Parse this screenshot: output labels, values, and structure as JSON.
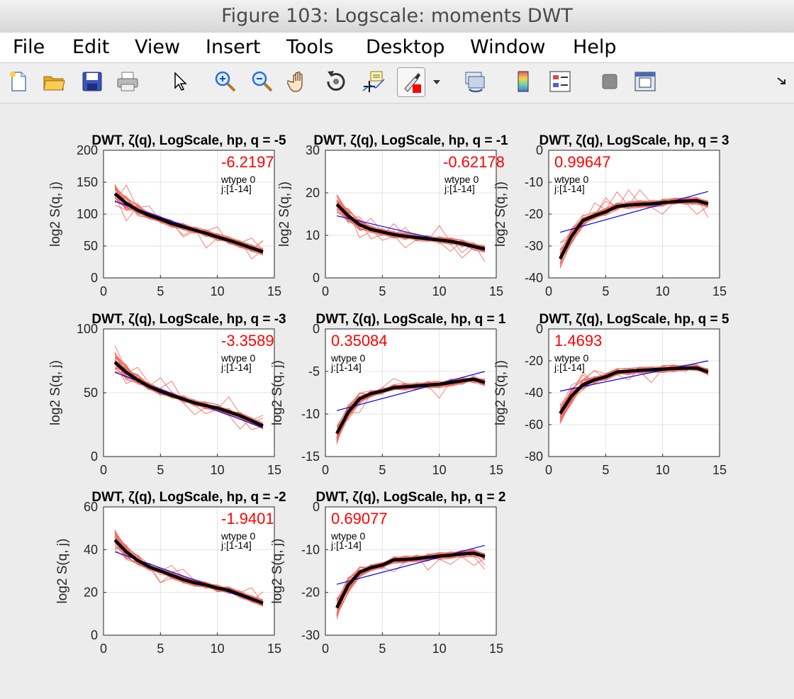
{
  "window": {
    "title": "Figure 103: Logscale: moments DWT"
  },
  "menu": [
    "File",
    "Edit",
    "View",
    "Insert",
    "Tools",
    "Desktop",
    "Window",
    "Help"
  ],
  "toolbar": {
    "buttons": [
      "new-figure-icon",
      "open-file-icon",
      "save-icon",
      "print-icon",
      "edit-plot-arrow-icon",
      "zoom-in-icon",
      "zoom-out-icon",
      "pan-hand-icon",
      "rotate-3d-icon",
      "data-cursor-icon",
      "brush-icon",
      "brush-dropdown-icon",
      "link-plot-icon",
      "insert-colorbar-icon",
      "insert-legend-icon",
      "hide-plot-tools-icon",
      "show-plot-tools-icon",
      "dock-arrow-icon"
    ]
  },
  "colors": {
    "red_lines": "#f06a60",
    "mean": "#000000",
    "fit": "#0000ff",
    "label_red": "#ff0000"
  },
  "chart_data": [
    {
      "type": "line",
      "title": "DWT, ζ(q), LogScale, hp, q = -5",
      "ylabel": "log2 S(q, j)",
      "xlim": [
        0,
        15
      ],
      "ylim": [
        0,
        200
      ],
      "xticks": [
        0,
        5,
        10,
        15
      ],
      "yticks": [
        0,
        50,
        100,
        150,
        200
      ],
      "grid": true,
      "annotation_value": "-6.2197",
      "annotation_text": [
        "wtype 0",
        "j:[1-14]"
      ],
      "mean": [
        132,
        117,
        106,
        98,
        92,
        85,
        80,
        75,
        70,
        64,
        59,
        53,
        47,
        41
      ],
      "fit": [
        {
          "x": 1,
          "y": 120
        },
        {
          "x": 14,
          "y": 39
        }
      ]
    },
    {
      "type": "line",
      "title": "DWT, ζ(q), LogScale, hp, q = -1",
      "ylabel": "log2 S(q, j)",
      "xlim": [
        0,
        15
      ],
      "ylim": [
        0,
        30
      ],
      "xticks": [
        0,
        5,
        10,
        15
      ],
      "yticks": [
        0,
        10,
        20,
        30
      ],
      "grid": true,
      "annotation_value": "-0.62178",
      "annotation_text": [
        "wtype 0",
        "j:[1-14]"
      ],
      "mean": [
        17.3,
        14.6,
        12.5,
        11.4,
        10.8,
        10.2,
        9.8,
        9.5,
        9.2,
        8.9,
        8.6,
        8.1,
        7.4,
        6.8
      ],
      "fit": [
        {
          "x": 1,
          "y": 14.6
        },
        {
          "x": 14,
          "y": 6.5
        }
      ]
    },
    {
      "type": "line",
      "title": "DWT, ζ(q), LogScale, hp, q = 3",
      "ylabel": "log2 S(q, j)",
      "xlim": [
        0,
        15
      ],
      "ylim": [
        -40,
        0
      ],
      "xticks": [
        0,
        5,
        10,
        15
      ],
      "yticks": [
        -40,
        -30,
        -20,
        -10,
        0
      ],
      "grid": true,
      "annotation_value": "0.99647",
      "annotation_text": [
        "wtype 0",
        "j:[1-14]"
      ],
      "mean": [
        -34,
        -27,
        -22,
        -20.5,
        -19.3,
        -17.6,
        -17.2,
        -16.9,
        -16.8,
        -16.4,
        -16.1,
        -15.9,
        -15.8,
        -16.8
      ],
      "fit": [
        {
          "x": 1,
          "y": -25.7
        },
        {
          "x": 14,
          "y": -12.9
        }
      ]
    },
    {
      "type": "line",
      "title": "DWT, ζ(q), LogScale, hp, q = -3",
      "ylabel": "log2 S(q, j)",
      "xlim": [
        0,
        15
      ],
      "ylim": [
        0,
        100
      ],
      "xticks": [
        0,
        5,
        10,
        15
      ],
      "yticks": [
        0,
        50,
        100
      ],
      "grid": true,
      "annotation_value": "-3.3589",
      "annotation_text": [
        "wtype 0",
        "j:[1-14]"
      ],
      "mean": [
        74,
        66,
        60,
        55,
        51,
        48,
        45,
        42,
        40,
        38,
        35,
        32,
        28,
        24
      ],
      "fit": [
        {
          "x": 1,
          "y": 66
        },
        {
          "x": 14,
          "y": 22.5
        }
      ]
    },
    {
      "type": "line",
      "title": "DWT, ζ(q), LogScale, hp, q = 1",
      "ylabel": "log2 S(q, j)",
      "xlim": [
        0,
        15
      ],
      "ylim": [
        -15,
        0
      ],
      "xticks": [
        0,
        5,
        10,
        15
      ],
      "yticks": [
        -15,
        -10,
        -5,
        0
      ],
      "grid": true,
      "annotation_value": "0.35084",
      "annotation_text": [
        "wtype 0",
        "j:[1-14]"
      ],
      "mean": [
        -12.3,
        -9.8,
        -8.2,
        -7.6,
        -7.3,
        -6.9,
        -6.8,
        -6.7,
        -6.6,
        -6.5,
        -6.3,
        -6.1,
        -5.9,
        -6.3
      ],
      "fit": [
        {
          "x": 1,
          "y": -9.6
        },
        {
          "x": 14,
          "y": -5.0
        }
      ]
    },
    {
      "type": "line",
      "title": "DWT, ζ(q), LogScale, hp, q = 5",
      "ylabel": "log2 S(q, j)",
      "xlim": [
        0,
        15
      ],
      "ylim": [
        -80,
        0
      ],
      "xticks": [
        0,
        5,
        10,
        15
      ],
      "yticks": [
        -80,
        -60,
        -40,
        -20,
        0
      ],
      "grid": true,
      "annotation_value": "1.4693",
      "annotation_text": [
        "wtype 0",
        "j:[1-14]"
      ],
      "mean": [
        -53,
        -42,
        -35,
        -32,
        -30,
        -27,
        -26.5,
        -26,
        -25.6,
        -25.2,
        -24.8,
        -24.6,
        -24.5,
        -27
      ],
      "fit": [
        {
          "x": 1,
          "y": -39
        },
        {
          "x": 14,
          "y": -20
        }
      ]
    },
    {
      "type": "line",
      "title": "DWT, ζ(q), LogScale, hp, q = -2",
      "ylabel": "log2 S(q, j)",
      "xlim": [
        0,
        15
      ],
      "ylim": [
        0,
        60
      ],
      "xticks": [
        0,
        5,
        10,
        15
      ],
      "yticks": [
        0,
        20,
        40,
        60
      ],
      "grid": true,
      "annotation_value": "-1.9401",
      "annotation_text": [
        "wtype 0",
        "j:[1-14]"
      ],
      "mean": [
        44.5,
        39,
        35,
        32,
        30,
        28,
        26,
        24.5,
        23.5,
        22,
        21,
        19,
        17,
        15
      ],
      "fit": [
        {
          "x": 1,
          "y": 39
        },
        {
          "x": 14,
          "y": 14.5
        }
      ]
    },
    {
      "type": "line",
      "title": "DWT, ζ(q), LogScale, hp, q = 2",
      "ylabel": "log2 S(q, j)",
      "xlim": [
        0,
        15
      ],
      "ylim": [
        -30,
        0
      ],
      "xticks": [
        0,
        5,
        10,
        15
      ],
      "yticks": [
        -30,
        -20,
        -10,
        0
      ],
      "grid": true,
      "annotation_value": "0.69077",
      "annotation_text": [
        "wtype 0",
        "j:[1-14]"
      ],
      "mean": [
        -23.6,
        -18.3,
        -15.3,
        -14.2,
        -13.6,
        -12.4,
        -12.3,
        -12.1,
        -11.8,
        -11.5,
        -11.3,
        -11.0,
        -10.8,
        -11.6
      ],
      "fit": [
        {
          "x": 1,
          "y": -18.1
        },
        {
          "x": 14,
          "y": -9.0
        }
      ]
    }
  ]
}
